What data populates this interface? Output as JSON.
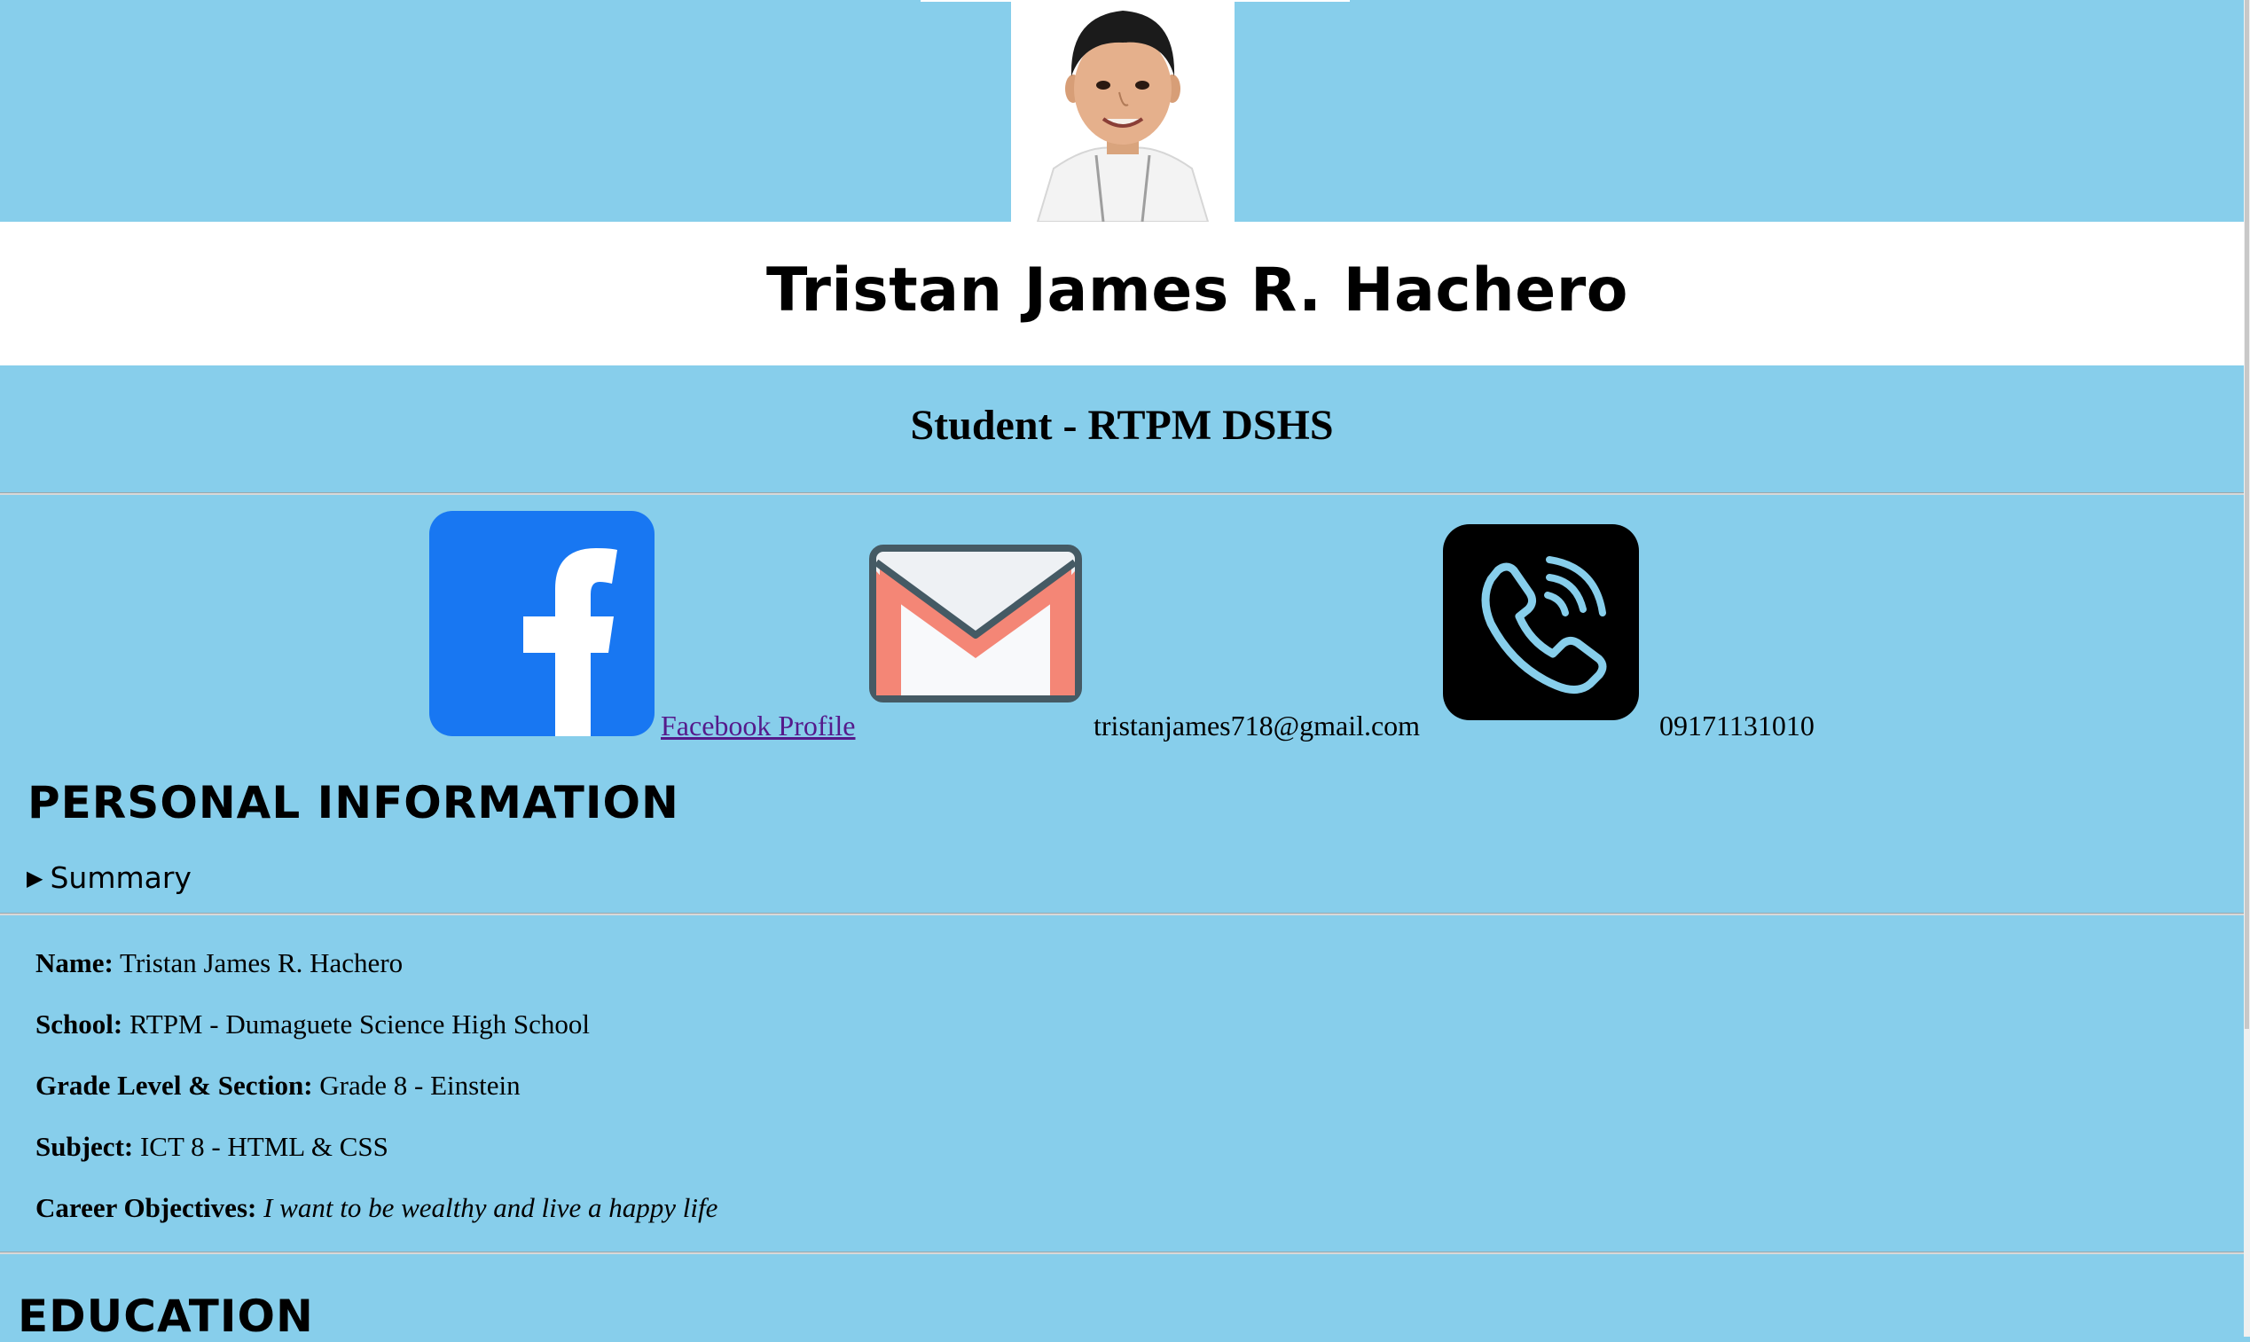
{
  "profile": {
    "name": "Tristan James R. Hachero",
    "subtitle": "Student - RTPM DSHS"
  },
  "contacts": {
    "facebook_label": "Facebook Profile",
    "email": "tristanjames718@gmail.com",
    "phone": "09171131010"
  },
  "personal_info": {
    "heading": "PERSONAL INFORMATION",
    "summary_label": "Summary",
    "rows": [
      {
        "label": "Name:",
        "value": "Tristan James R. Hachero"
      },
      {
        "label": "School:",
        "value": "RTPM - Dumaguete Science High School"
      },
      {
        "label": "Grade Level & Section:",
        "value": "Grade 8 - Einstein"
      },
      {
        "label": "Subject:",
        "value": "ICT 8 - HTML & CSS"
      },
      {
        "label": "Career Objectives:",
        "value": "I want to be wealthy and live a happy life"
      }
    ]
  },
  "education": {
    "heading": "EDUCATION"
  },
  "colors": {
    "page_background": "#87ceeb",
    "name_band": "#ffffff",
    "facebook_blue": "#1877f2",
    "gmail_red": "#f48676",
    "viber_black": "#000000",
    "link_visited": "#551a8b"
  },
  "icons": [
    "facebook-icon",
    "gmail-icon",
    "phone-icon"
  ]
}
